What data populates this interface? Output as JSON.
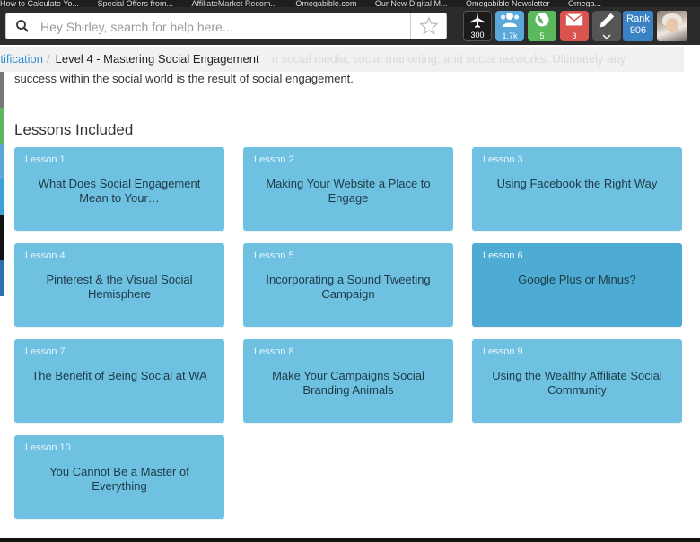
{
  "browser": {
    "bookmarks": [
      "How to Calculate Yo...",
      "Special Offers from...",
      "AffiliateMarket Recom...",
      "Omegabible.com",
      "Our New Digital M...",
      "Omegabible Newsletter",
      "Omega..."
    ]
  },
  "header": {
    "search_placeholder": "Hey Shirley, search for help here...",
    "tools": [
      {
        "icon": "airplane-icon",
        "badge": "300",
        "color": "#1b1b1b"
      },
      {
        "icon": "users-icon",
        "badge": "1.7k",
        "color": "#5aa7d9"
      },
      {
        "icon": "globe-icon",
        "badge": "5",
        "color": "#5cb85c"
      },
      {
        "icon": "mail-icon",
        "badge": "3",
        "color": "#d9534f"
      },
      {
        "icon": "pencil-icon",
        "badge": "",
        "color": "#555555"
      }
    ],
    "rank_label": "Rank",
    "rank_value": "906"
  },
  "breadcrumb": {
    "parent": "rtification",
    "separator": "/",
    "current": "Level 4 - Mastering Social Engagement",
    "ghost_text": "n social media, social marketing, and social networks. Ultimately any"
  },
  "intro_text": "success within the social world is the result of social engagement.",
  "section_title": "Lessons Included",
  "lessons": [
    {
      "num": "Lesson 1",
      "title": "What Does Social Engagement Mean to Your…"
    },
    {
      "num": "Lesson 2",
      "title": "Making Your Website a Place to Engage"
    },
    {
      "num": "Lesson 3",
      "title": "Using Facebook the Right Way"
    },
    {
      "num": "Lesson 4",
      "title": "Pinterest & the Visual Social Hemisphere"
    },
    {
      "num": "Lesson 5",
      "title": "Incorporating a Sound Tweeting Campaign"
    },
    {
      "num": "Lesson 6",
      "title": "Google Plus or Minus?"
    },
    {
      "num": "Lesson 7",
      "title": "The Benefit of Being Social at WA"
    },
    {
      "num": "Lesson 8",
      "title": "Make Your Campaigns Social Branding Animals"
    },
    {
      "num": "Lesson 9",
      "title": "Using the Wealthy Affiliate Social Community"
    },
    {
      "num": "Lesson 10",
      "title": "You Cannot Be a Master of Everything"
    }
  ],
  "colors": {
    "card": "#6ec1e1",
    "card_active": "#4eacd4",
    "link": "#2f8fd6"
  }
}
